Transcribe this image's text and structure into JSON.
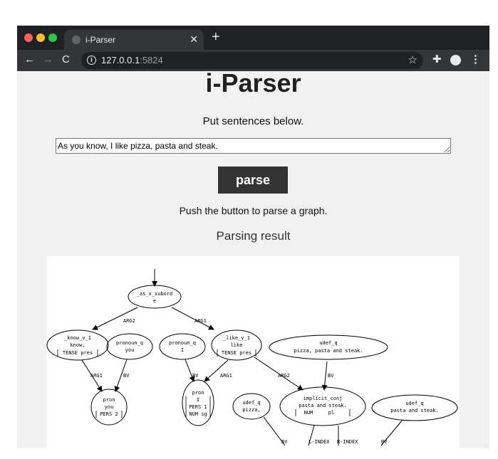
{
  "browser": {
    "tab_title": "i-Parser",
    "url_host": "127.0.0.1",
    "url_port": ":5824"
  },
  "page": {
    "title": "i-Parser",
    "instruction": "Put sentences below.",
    "input_value": "As you know, I like pizza, pasta and steak.",
    "parse_button": "parse",
    "hint": "Push the button to parse a graph.",
    "result_heading": "Parsing result"
  },
  "graph": {
    "nodes": [
      {
        "id": "as",
        "label1": "_as_x_subord",
        "label2": "e"
      },
      {
        "id": "know",
        "label1": "_know_v_1",
        "label2": "know,",
        "label3": "TENSE pres"
      },
      {
        "id": "pronoun1",
        "label1": "pronoun_q",
        "label2": "you"
      },
      {
        "id": "pronoun2",
        "label1": "pronoun_q",
        "label2": "I"
      },
      {
        "id": "like",
        "label1": "_like_v_1",
        "label2": "like",
        "label3": "TENSE pres"
      },
      {
        "id": "udef1",
        "label1": "udef_q",
        "label2": "pizza, pasta and steak."
      },
      {
        "id": "pron1",
        "label1": "pron",
        "label2": "you",
        "label3": "PERS 2"
      },
      {
        "id": "pron2",
        "label1": "pron",
        "label2": "I",
        "label3": "PERS 1",
        "label4": "NUM sg"
      },
      {
        "id": "udef2",
        "label1": "udef_q",
        "label2": "pizza,"
      },
      {
        "id": "implicit",
        "label1": "implicit_conj",
        "label2": "pasta and steak.",
        "label3": "NUM",
        "label3b": "pl"
      },
      {
        "id": "udef3",
        "label1": "udef_q",
        "label2": "pasta and steak."
      }
    ],
    "edges": [
      "ARG2",
      "ARG1",
      "ARG1",
      "BV",
      "BV",
      "ARG1",
      "ARG2",
      "BV",
      "BV",
      "L-INDEX",
      "R-INDEX",
      "BV"
    ]
  }
}
